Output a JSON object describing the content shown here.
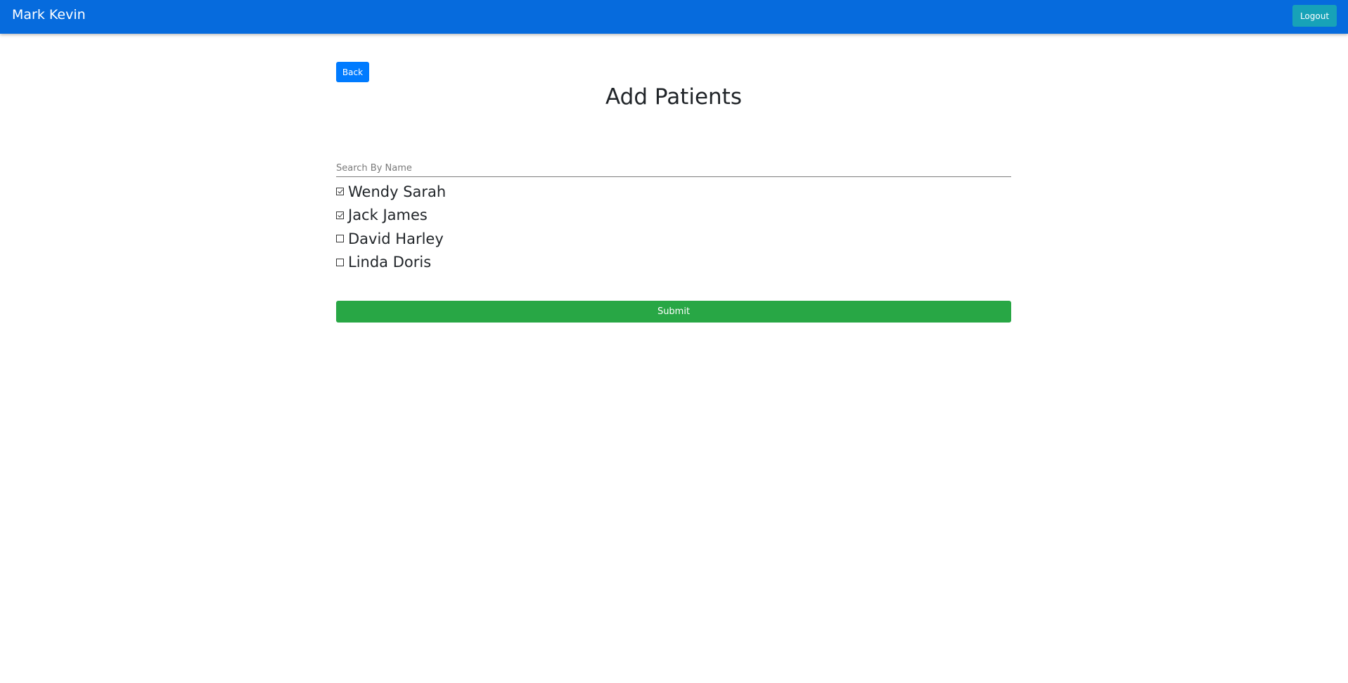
{
  "navbar": {
    "brand": "Mark Kevin",
    "logout_label": "Logout"
  },
  "page": {
    "back_label": "Back",
    "title": "Add Patients",
    "search_placeholder": "Search By Name",
    "search_value": "",
    "submit_label": "Submit"
  },
  "patients": [
    {
      "name": "Wendy Sarah",
      "checked": true
    },
    {
      "name": "Jack James",
      "checked": true
    },
    {
      "name": "David Harley",
      "checked": false
    },
    {
      "name": "Linda Doris",
      "checked": false
    }
  ],
  "colors": {
    "navbar": "#066bdd",
    "logout": "#17a2b8",
    "back": "#007bff",
    "submit": "#28a745"
  }
}
